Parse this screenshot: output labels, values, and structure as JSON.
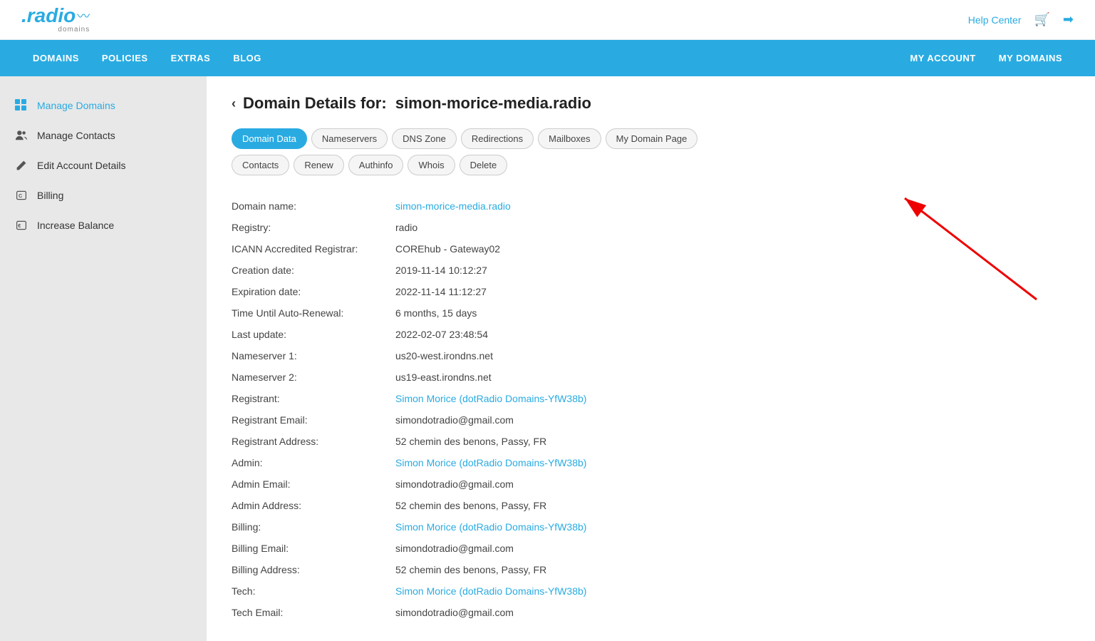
{
  "header": {
    "logo_text": ".radio",
    "logo_sub": "domains",
    "help_center": "Help Center",
    "cart_icon": "🛒",
    "login_icon": "➡|"
  },
  "nav": {
    "left": [
      "DOMAINS",
      "POLICIES",
      "EXTRAS",
      "BLOG"
    ],
    "right": [
      "MY ACCOUNT",
      "MY DOMAINS"
    ]
  },
  "sidebar": {
    "items": [
      {
        "label": "Manage Domains",
        "icon": "grid",
        "active": true
      },
      {
        "label": "Manage Contacts",
        "icon": "people",
        "active": false
      },
      {
        "label": "Edit Account Details",
        "icon": "pencil",
        "active": false
      },
      {
        "label": "Billing",
        "icon": "billing",
        "active": false
      },
      {
        "label": "Increase Balance",
        "icon": "money",
        "active": false
      }
    ]
  },
  "page": {
    "back_label": "‹",
    "title_prefix": "Domain Details for:",
    "domain_name": "simon-morice-media.radio",
    "tabs": [
      {
        "label": "Domain Data",
        "active": true
      },
      {
        "label": "Nameservers",
        "active": false
      },
      {
        "label": "DNS Zone",
        "active": false
      },
      {
        "label": "Redirections",
        "active": false
      },
      {
        "label": "Mailboxes",
        "active": false
      },
      {
        "label": "My Domain Page",
        "active": false
      },
      {
        "label": "Contacts",
        "active": false
      },
      {
        "label": "Renew",
        "active": false
      },
      {
        "label": "Authinfo",
        "active": false
      },
      {
        "label": "Whois",
        "active": false
      },
      {
        "label": "Delete",
        "active": false
      }
    ],
    "details": [
      {
        "label": "Domain name:",
        "value": "simon-morice-media.radio",
        "is_link": true
      },
      {
        "label": "Registry:",
        "value": "radio",
        "is_link": false
      },
      {
        "label": "ICANN Accredited Registrar:",
        "value": "COREhub - Gateway02",
        "is_link": false
      },
      {
        "label": "Creation date:",
        "value": "2019-11-14 10:12:27",
        "is_link": false
      },
      {
        "label": "Expiration date:",
        "value": "2022-11-14 11:12:27",
        "is_link": false
      },
      {
        "label": "Time Until Auto-Renewal:",
        "value": "6 months, 15 days",
        "is_link": false
      },
      {
        "label": "Last update:",
        "value": "2022-02-07 23:48:54",
        "is_link": false
      },
      {
        "label": "Nameserver 1:",
        "value": "us20-west.irondns.net",
        "is_link": false
      },
      {
        "label": "Nameserver 2:",
        "value": "us19-east.irondns.net",
        "is_link": false
      },
      {
        "label": "Registrant:",
        "value": "Simon Morice (dotRadio Domains-YfW38b)",
        "is_link": true
      },
      {
        "label": "Registrant Email:",
        "value": "simondotradio@gmail.com",
        "is_link": false
      },
      {
        "label": "Registrant Address:",
        "value": "52 chemin des benons, Passy, FR",
        "is_link": false
      },
      {
        "label": "Admin:",
        "value": "Simon Morice (dotRadio Domains-YfW38b)",
        "is_link": true
      },
      {
        "label": "Admin Email:",
        "value": "simondotradio@gmail.com",
        "is_link": false
      },
      {
        "label": "Admin Address:",
        "value": "52 chemin des benons, Passy, FR",
        "is_link": false
      },
      {
        "label": "Billing:",
        "value": "Simon Morice (dotRadio Domains-YfW38b)",
        "is_link": true
      },
      {
        "label": "Billing Email:",
        "value": "simondotradio@gmail.com",
        "is_link": false
      },
      {
        "label": "Billing Address:",
        "value": "52 chemin des benons, Passy, FR",
        "is_link": false
      },
      {
        "label": "Tech:",
        "value": "Simon Morice (dotRadio Domains-YfW38b)",
        "is_link": true
      },
      {
        "label": "Tech Email:",
        "value": "simondotradio@gmail.com",
        "is_link": false
      }
    ]
  }
}
